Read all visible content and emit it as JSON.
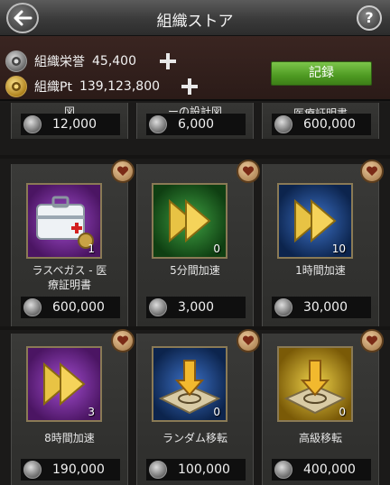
{
  "header": {
    "title": "組織ストア",
    "help_label": "?"
  },
  "currency": {
    "honor": {
      "label": "組織栄誉",
      "value": "45,400"
    },
    "points": {
      "label": "組織Pt",
      "value": "139,123,800"
    },
    "record_label": "記録"
  },
  "top_row": [
    {
      "name": "レジェンド設計\n図",
      "price": "12,000"
    },
    {
      "name": "コントラクター\nーの設計図",
      "price": "6,000"
    },
    {
      "name": "医療証明書",
      "price": "600,000"
    }
  ],
  "items": [
    {
      "name": "ラスベガス - 医\n療証明書",
      "qty": "1",
      "price": "600,000",
      "icon": "medical-kit-icon",
      "bg": "purple"
    },
    {
      "name": "5分間加速",
      "qty": "0",
      "price": "3,000",
      "icon": "speedup-arrow-icon",
      "bg": "green"
    },
    {
      "name": "1時間加速",
      "qty": "10",
      "price": "30,000",
      "icon": "speedup-arrow-icon",
      "bg": "blue"
    },
    {
      "name": "8時間加速",
      "qty": "3",
      "price": "190,000",
      "icon": "speedup-arrow-icon",
      "bg": "purple"
    },
    {
      "name": "ランダム移転",
      "qty": "0",
      "price": "100,000",
      "icon": "relocate-icon",
      "bg": "blue"
    },
    {
      "name": "高級移転",
      "qty": "0",
      "price": "400,000",
      "icon": "relocate-icon",
      "bg": "gold"
    }
  ]
}
